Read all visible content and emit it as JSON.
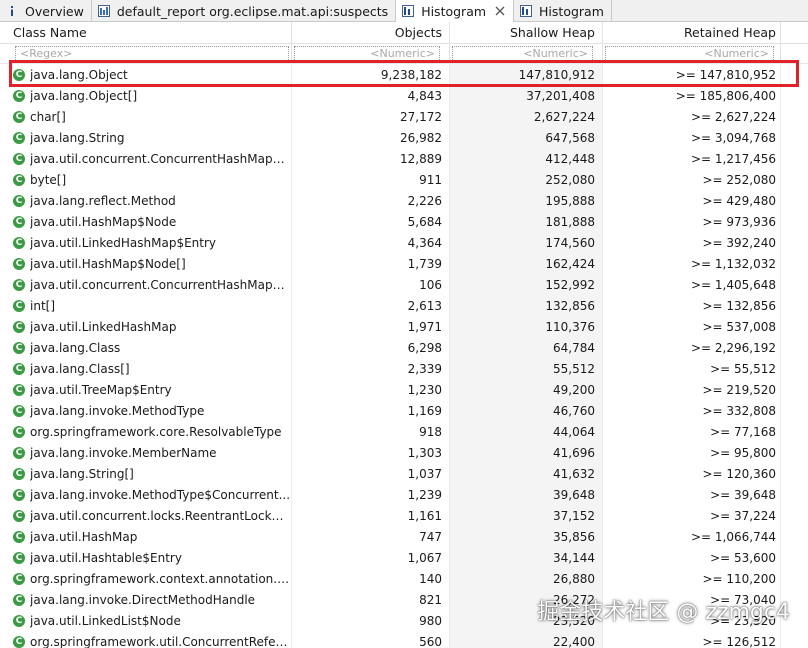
{
  "tabs": [
    {
      "label": "Overview",
      "icon": "info-icon"
    },
    {
      "label": "default_report org.eclipse.mat.api:suspects",
      "icon": "report-icon"
    },
    {
      "label": "Histogram",
      "icon": "histogram-icon",
      "active": true,
      "closable": true
    },
    {
      "label": "Histogram",
      "icon": "histogram-icon"
    }
  ],
  "columns": {
    "class_name": "Class Name",
    "objects": "Objects",
    "shallow_heap": "Shallow Heap",
    "retained_heap": "Retained Heap"
  },
  "filter": {
    "class_name": "<Regex>",
    "objects": "<Numeric>",
    "shallow_heap": "<Numeric>",
    "retained_heap": "<Numeric>"
  },
  "rows": [
    {
      "name": "java.lang.Object",
      "objects": "9,238,182",
      "shallow": "147,810,912",
      "retained": ">= 147,810,952"
    },
    {
      "name": "java.lang.Object[]",
      "objects": "4,843",
      "shallow": "37,201,408",
      "retained": ">= 185,806,400"
    },
    {
      "name": "char[]",
      "objects": "27,172",
      "shallow": "2,627,224",
      "retained": ">= 2,627,224"
    },
    {
      "name": "java.lang.String",
      "objects": "26,982",
      "shallow": "647,568",
      "retained": ">= 3,094,768"
    },
    {
      "name": "java.util.concurrent.ConcurrentHashMap$N...",
      "objects": "12,889",
      "shallow": "412,448",
      "retained": ">= 1,217,456"
    },
    {
      "name": "byte[]",
      "objects": "911",
      "shallow": "252,080",
      "retained": ">= 252,080"
    },
    {
      "name": "java.lang.reflect.Method",
      "objects": "2,226",
      "shallow": "195,888",
      "retained": ">= 429,480"
    },
    {
      "name": "java.util.HashMap$Node",
      "objects": "5,684",
      "shallow": "181,888",
      "retained": ">= 973,936"
    },
    {
      "name": "java.util.LinkedHashMap$Entry",
      "objects": "4,364",
      "shallow": "174,560",
      "retained": ">= 392,240"
    },
    {
      "name": "java.util.HashMap$Node[]",
      "objects": "1,739",
      "shallow": "162,424",
      "retained": ">= 1,132,032"
    },
    {
      "name": "java.util.concurrent.ConcurrentHashMap$N...",
      "objects": "106",
      "shallow": "152,992",
      "retained": ">= 1,405,648"
    },
    {
      "name": "int[]",
      "objects": "2,613",
      "shallow": "132,856",
      "retained": ">= 132,856"
    },
    {
      "name": "java.util.LinkedHashMap",
      "objects": "1,971",
      "shallow": "110,376",
      "retained": ">= 537,008"
    },
    {
      "name": "java.lang.Class",
      "objects": "6,298",
      "shallow": "64,784",
      "retained": ">= 2,296,192"
    },
    {
      "name": "java.lang.Class[]",
      "objects": "2,339",
      "shallow": "55,512",
      "retained": ">= 55,512"
    },
    {
      "name": "java.util.TreeMap$Entry",
      "objects": "1,230",
      "shallow": "49,200",
      "retained": ">= 219,520"
    },
    {
      "name": "java.lang.invoke.MethodType",
      "objects": "1,169",
      "shallow": "46,760",
      "retained": ">= 332,808"
    },
    {
      "name": "org.springframework.core.ResolvableType",
      "objects": "918",
      "shallow": "44,064",
      "retained": ">= 77,168"
    },
    {
      "name": "java.lang.invoke.MemberName",
      "objects": "1,303",
      "shallow": "41,696",
      "retained": ">= 95,800"
    },
    {
      "name": "java.lang.String[]",
      "objects": "1,037",
      "shallow": "41,632",
      "retained": ">= 120,360"
    },
    {
      "name": "java.lang.invoke.MethodType$Concurrent...",
      "objects": "1,239",
      "shallow": "39,648",
      "retained": ">= 39,648"
    },
    {
      "name": "java.util.concurrent.locks.ReentrantLock$N...",
      "objects": "1,161",
      "shallow": "37,152",
      "retained": ">= 37,224"
    },
    {
      "name": "java.util.HashMap",
      "objects": "747",
      "shallow": "35,856",
      "retained": ">= 1,066,744"
    },
    {
      "name": "java.util.Hashtable$Entry",
      "objects": "1,067",
      "shallow": "34,144",
      "retained": ">= 53,600"
    },
    {
      "name": "org.springframework.context.annotation.C...",
      "objects": "140",
      "shallow": "26,880",
      "retained": ">= 110,200"
    },
    {
      "name": "java.lang.invoke.DirectMethodHandle",
      "objects": "821",
      "shallow": "26,272",
      "retained": ">= 73,040"
    },
    {
      "name": "java.util.LinkedList$Node",
      "objects": "980",
      "shallow": "23,520",
      "retained": ">= 23,520"
    },
    {
      "name": "org.springframework.util.ConcurrentRefere...",
      "objects": "560",
      "shallow": "22,400",
      "retained": ">= 126,512"
    }
  ],
  "class_icon_letter": "C",
  "colors": {
    "class_icon": "#3b9b44",
    "highlight_border": "#e0232a",
    "shallow_column_bg": "#f4f4f4"
  },
  "watermark": "掘金技术社区 @ zzmgc4"
}
